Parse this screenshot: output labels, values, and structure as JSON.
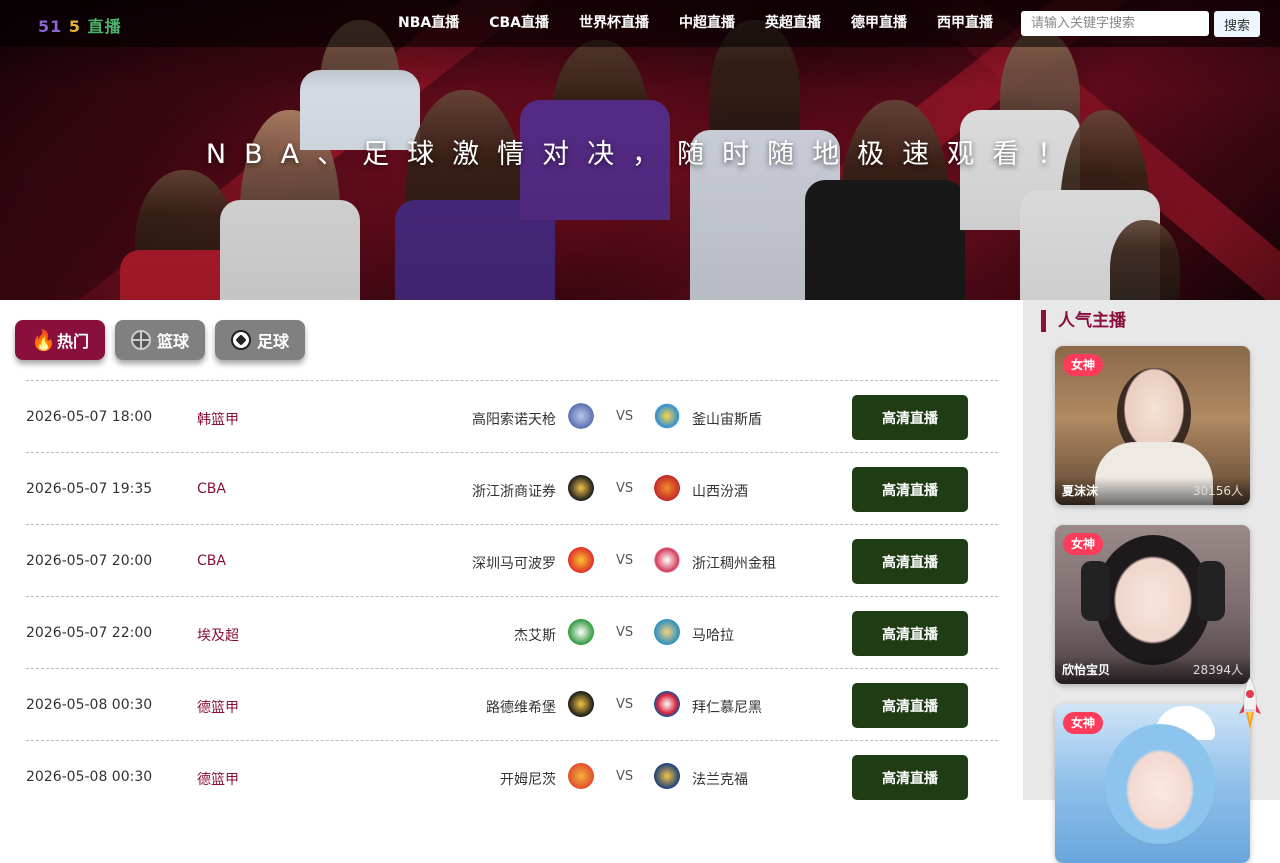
{
  "header": {
    "logo": {
      "part1": "51",
      "part2": "5",
      "part3": "直播"
    },
    "nav": [
      "NBA直播",
      "CBA直播",
      "世界杯直播",
      "中超直播",
      "英超直播",
      "德甲直播",
      "西甲直播"
    ],
    "search_placeholder": "请输入关键字搜索",
    "search_button": "搜索",
    "slogan": "NBA、足球激情对决，随时随地极速观看！"
  },
  "tabs": [
    {
      "label": "热门",
      "icon": "flame-icon",
      "active": true
    },
    {
      "label": "篮球",
      "icon": "basketball-icon",
      "active": false
    },
    {
      "label": "足球",
      "icon": "soccer-ball-icon",
      "active": false
    }
  ],
  "matches": [
    {
      "time": "2026-05-07 18:00",
      "league": "韩篮甲",
      "home": "高阳索诺天枪",
      "away": "釜山宙斯盾",
      "button": "高清直播"
    },
    {
      "time": "2026-05-07 19:35",
      "league": "CBA",
      "home": "浙江浙商证券",
      "away": "山西汾酒",
      "button": "高清直播"
    },
    {
      "time": "2026-05-07 20:00",
      "league": "CBA",
      "home": "深圳马可波罗",
      "away": "浙江稠州金租",
      "button": "高清直播"
    },
    {
      "time": "2026-05-07 22:00",
      "league": "埃及超",
      "home": "杰艾斯",
      "away": "马哈拉",
      "button": "高清直播"
    },
    {
      "time": "2026-05-08 00:30",
      "league": "德篮甲",
      "home": "路德维希堡",
      "away": "拜仁慕尼黑",
      "button": "高清直播"
    },
    {
      "time": "2026-05-08 00:30",
      "league": "德篮甲",
      "home": "开姆尼茨",
      "away": "法兰克福",
      "button": "高清直播"
    }
  ],
  "vs_label": "VS",
  "sidebar": {
    "title": "人气主播",
    "streamers": [
      {
        "tag": "女神",
        "name": "夏沫沫",
        "viewers": "30156人"
      },
      {
        "tag": "女神",
        "name": "欣怡宝贝",
        "viewers": "28394人"
      },
      {
        "tag": "女神",
        "name": "",
        "viewers": ""
      }
    ]
  },
  "colors": {
    "accent": "#8a0f3c",
    "live_button": "#1f3d14",
    "tab_inactive": "#808080",
    "tag": "#ff3b5c"
  }
}
